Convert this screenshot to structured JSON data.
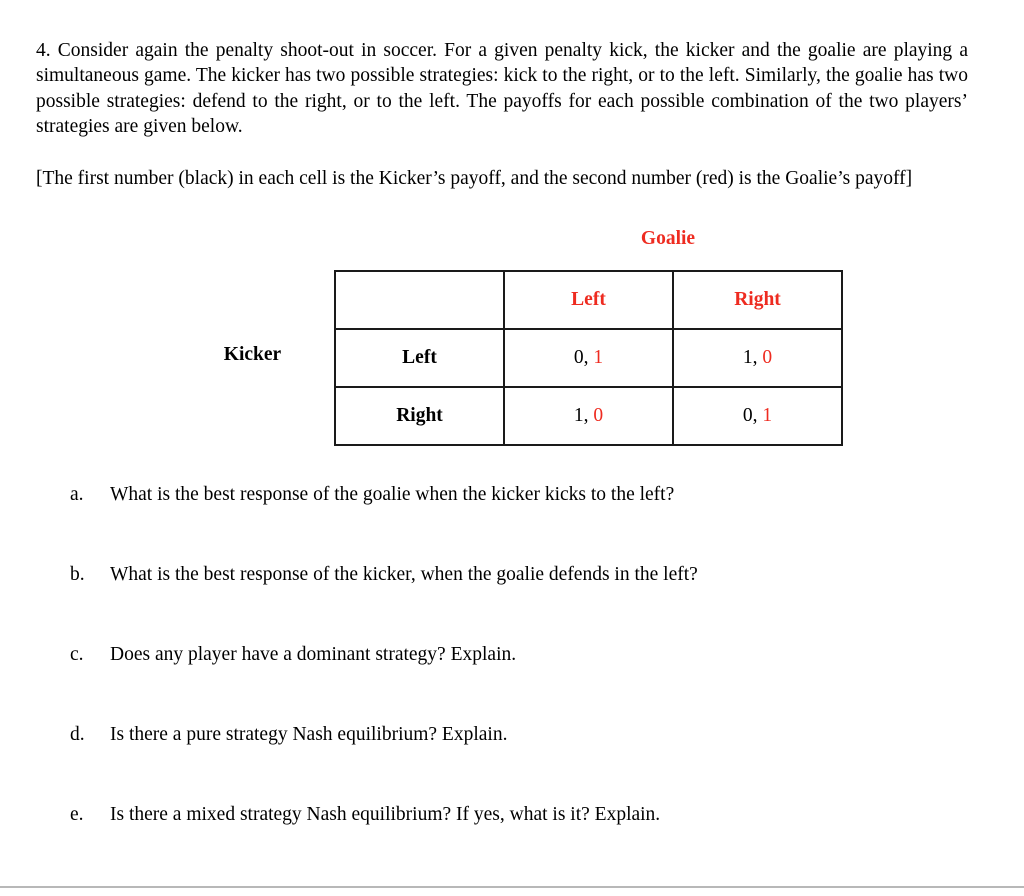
{
  "document": {
    "question_number": "4.",
    "intro_paragraph": "4. Consider again the penalty shoot-out in soccer. For a given penalty kick, the kicker and the goalie are playing a simultaneous game. The kicker has two possible strategies: kick to the right, or to the left. Similarly, the goalie has two possible strategies: defend to the right, or to the left. The payoffs for each possible combination of the two players’ strategies are given below.",
    "note_paragraph": "[The first number (black) in each cell is the Kicker’s payoff, and the second number (red) is the Goalie’s payoff]"
  },
  "colors": {
    "red_accent": "#ee2b20",
    "text_black": "#000000",
    "table_border": "#1a1a1a",
    "bottom_rule": "#b8b8b8"
  },
  "matrix": {
    "column_player_label": "Goalie",
    "row_player_label": "Kicker",
    "corner_cell": "",
    "column_headers": [
      "Left",
      "Right"
    ],
    "row_headers": [
      "Left",
      "Right"
    ],
    "cells": [
      [
        {
          "first": "0,",
          "second": "1"
        },
        {
          "first": "1,",
          "second": "0"
        }
      ],
      [
        {
          "first": "1,",
          "second": "0"
        },
        {
          "first": "0,",
          "second": "1"
        }
      ]
    ],
    "payoff_values": {
      "kicker": [
        [
          0,
          1
        ],
        [
          1,
          0
        ]
      ],
      "goalie": [
        [
          1,
          0
        ],
        [
          0,
          1
        ]
      ]
    }
  },
  "questions": [
    {
      "marker": "a.",
      "text": "What is the best response of the goalie when the kicker kicks to the left?"
    },
    {
      "marker": "b.",
      "text": "What is the best response of the kicker, when the goalie defends in the left?"
    },
    {
      "marker": "c.",
      "text": "Does any player have a dominant strategy? Explain."
    },
    {
      "marker": "d.",
      "text": "Is there a pure strategy Nash equilibrium? Explain."
    },
    {
      "marker": "e.",
      "text": "Is there a mixed strategy Nash equilibrium? If yes, what is it? Explain."
    }
  ]
}
